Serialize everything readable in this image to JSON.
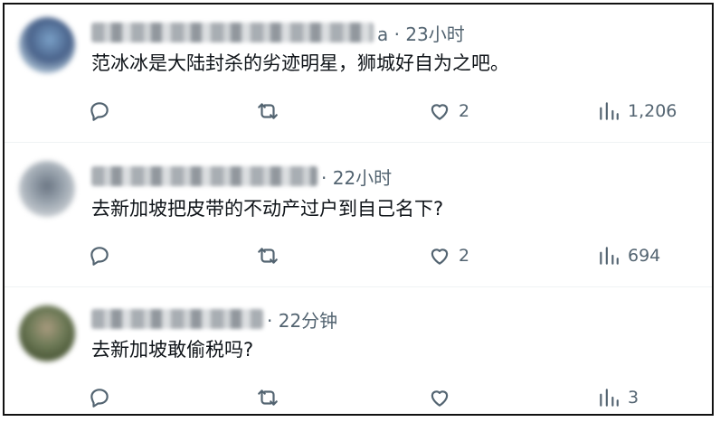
{
  "tweets": [
    {
      "time": "a · 23小时",
      "text": "范冰冰是大陆封杀的劣迹明星，狮城好自为之吧。",
      "likes": "2",
      "views": "1,206"
    },
    {
      "time": "· 22小时",
      "text": "去新加坡把皮带的不动产过户到自己名下?",
      "likes": "2",
      "views": "694"
    },
    {
      "time": "· 22分钟",
      "text": "去新加坡敢偷税吗?",
      "likes": "",
      "views": "3"
    }
  ],
  "icons": {
    "reply": "reply-icon",
    "retweet": "retweet-icon",
    "like": "heart-icon",
    "views": "views-bar-chart-icon"
  },
  "colors": {
    "text": "#0f1419",
    "secondary": "#536471",
    "divider": "#eff3f4"
  }
}
